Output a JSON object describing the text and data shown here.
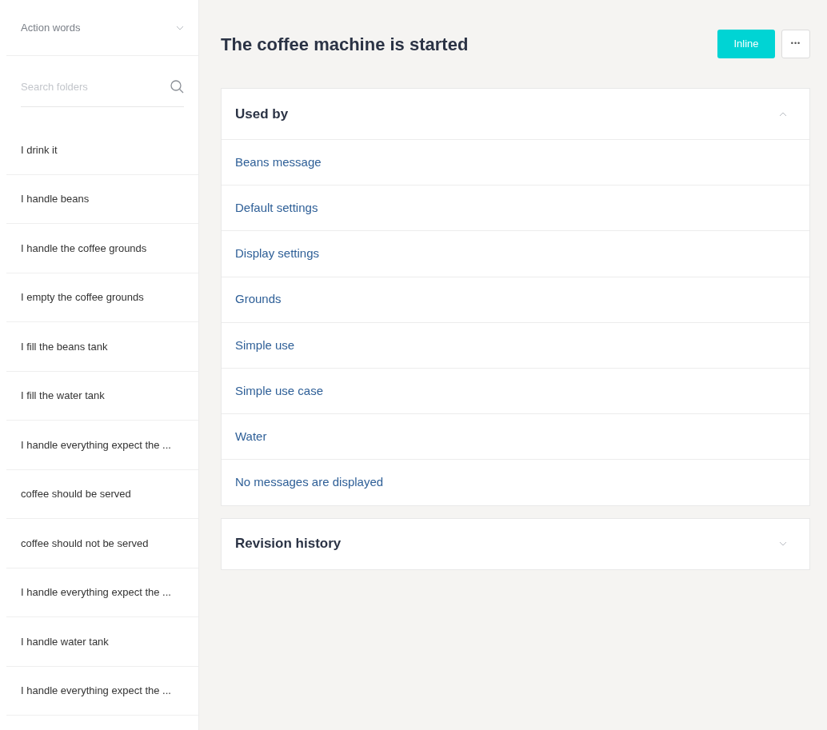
{
  "sidebar": {
    "dropdown": {
      "label": "Action words",
      "expanded": false
    },
    "search": {
      "placeholder": "Search folders"
    },
    "items": [
      {
        "label": "I drink it"
      },
      {
        "label": "I handle beans"
      },
      {
        "label": "I handle the coffee grounds"
      },
      {
        "label": "I empty the coffee grounds"
      },
      {
        "label": "I fill the beans tank"
      },
      {
        "label": "I fill the water tank"
      },
      {
        "label": "I handle everything expect the ..."
      },
      {
        "label": "coffee should be served"
      },
      {
        "label": "coffee should not be served"
      },
      {
        "label": "I handle everything expect the ..."
      },
      {
        "label": "I handle water tank"
      },
      {
        "label": "I handle everything expect the ..."
      }
    ]
  },
  "header": {
    "title": "The coffee machine is started",
    "primary_button": "Inline",
    "more_button": "•••"
  },
  "sections": [
    {
      "title": "Used by",
      "expanded": true,
      "links": [
        "Beans message",
        "Default settings",
        "Display settings",
        "Grounds",
        "Simple use",
        "Simple use case",
        "Water",
        "No messages are displayed"
      ]
    },
    {
      "title": "Revision history",
      "expanded": false
    }
  ]
}
